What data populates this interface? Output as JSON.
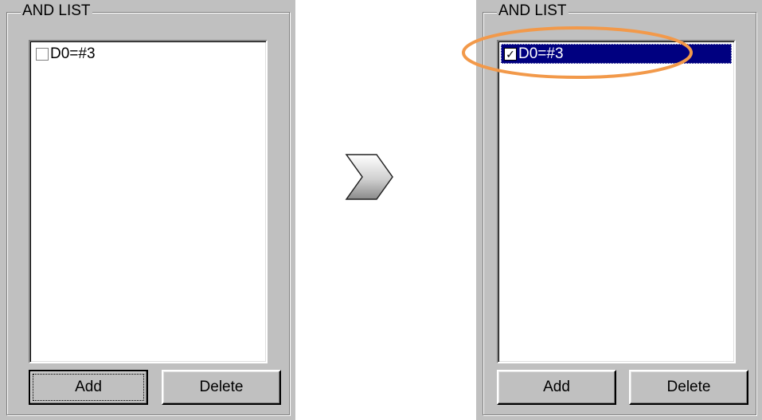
{
  "before": {
    "group_title": "AND LIST",
    "items": [
      {
        "label": "D0=#3",
        "checked": false,
        "selected": false
      }
    ],
    "add_label": "Add",
    "delete_label": "Delete"
  },
  "after": {
    "group_title": "AND LIST",
    "items": [
      {
        "label": "D0=#3",
        "checked": true,
        "selected": true
      }
    ],
    "add_label": "Add",
    "delete_label": "Delete"
  },
  "transition_icon": "chevron-right-icon",
  "colors": {
    "dialog_bg": "#c0c0c0",
    "selection_bg": "#000080",
    "highlight_ring": "#f2994a"
  }
}
